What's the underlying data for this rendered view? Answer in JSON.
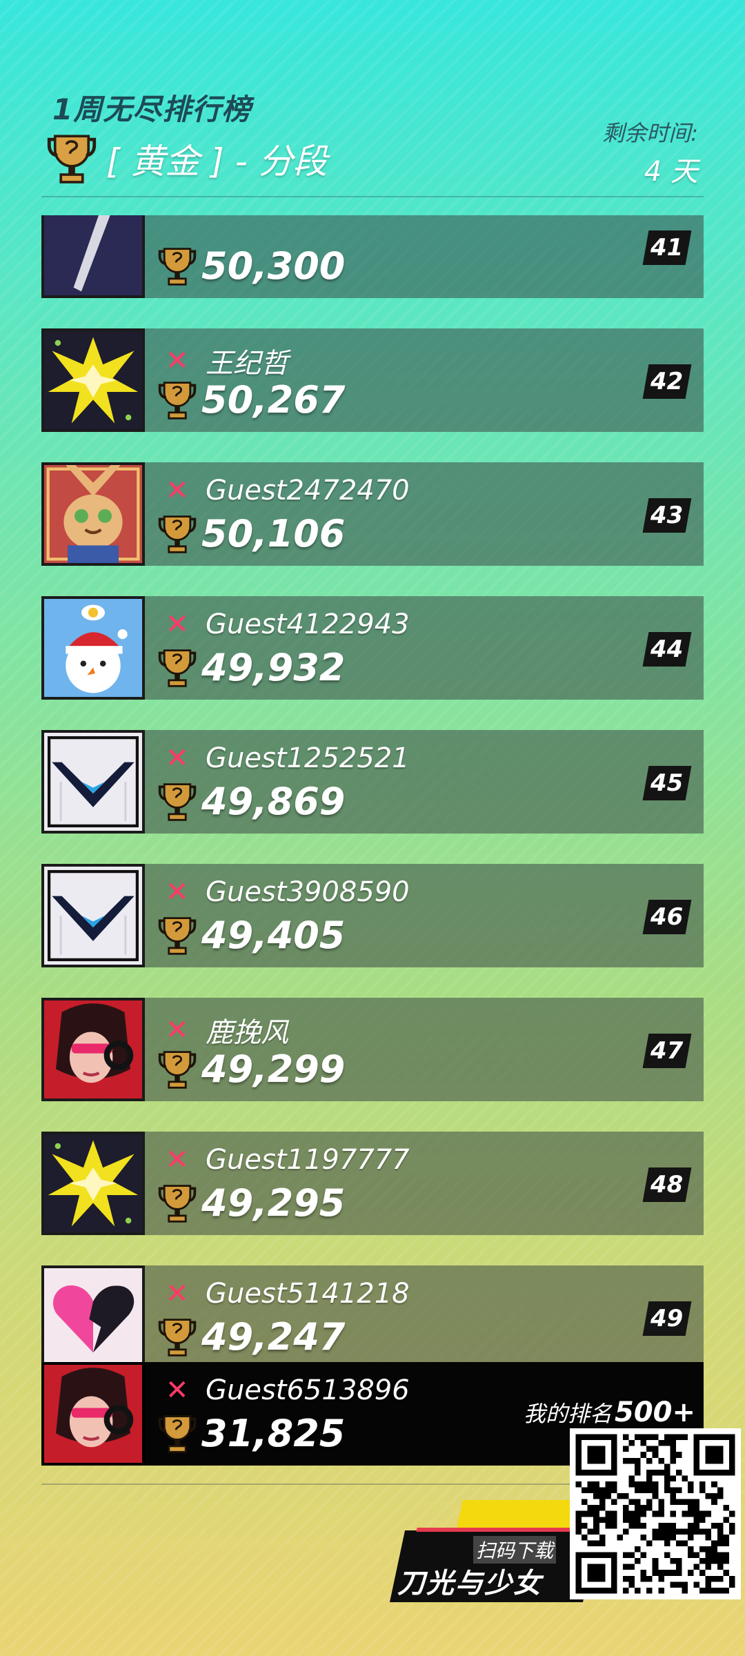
{
  "header": {
    "title": "1周无尽排行榜",
    "tier_label": "[ 黄金 ] - 分段",
    "remaining_label": "剩余时间:",
    "remaining_value": "4 天"
  },
  "rows": [
    {
      "name": "",
      "score": "50,300",
      "rank": "41",
      "avatar": "dagger-avatar"
    },
    {
      "name": "王纪哲",
      "score": "50,267",
      "rank": "42",
      "avatar": "burst-avatar"
    },
    {
      "name": "Guest2472470",
      "score": "50,106",
      "rank": "43",
      "avatar": "owl-avatar"
    },
    {
      "name": "Guest4122943",
      "score": "49,932",
      "rank": "44",
      "avatar": "snowman-avatar"
    },
    {
      "name": "Guest1252521",
      "score": "49,869",
      "rank": "45",
      "avatar": "chevron-avatar"
    },
    {
      "name": "Guest3908590",
      "score": "49,405",
      "rank": "46",
      "avatar": "chevron-avatar"
    },
    {
      "name": "鹿挽风",
      "score": "49,299",
      "rank": "47",
      "avatar": "girl-avatar"
    },
    {
      "name": "Guest1197777",
      "score": "49,295",
      "rank": "48",
      "avatar": "burst-avatar"
    },
    {
      "name": "Guest5141218",
      "score": "49,247",
      "rank": "49",
      "avatar": "heart-avatar"
    }
  ],
  "my_entry": {
    "name": "Guest6513896",
    "score": "31,825",
    "rank_label": "我的排名",
    "rank_value": "500+",
    "avatar": "girl-avatar"
  },
  "promo": {
    "scan_label": "扫码下载",
    "game_name": "刀光与少女"
  },
  "icons": {
    "trophy": "trophy-icon",
    "remove": "x-icon",
    "qr": "qr-code"
  },
  "colors": {
    "accent_red": "#ff3a68",
    "gold": "#d29a3a",
    "row_bg": "#3a4846"
  }
}
